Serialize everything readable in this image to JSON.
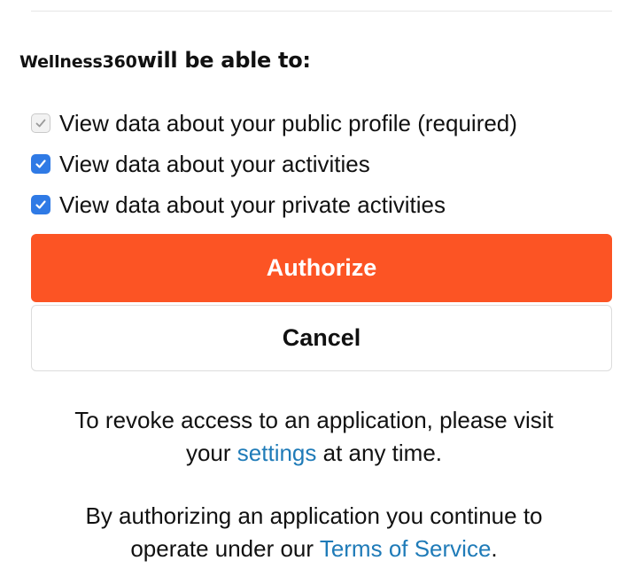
{
  "header": {
    "app_name": "Wellness360",
    "heading_suffix": "will be able to:"
  },
  "permissions": [
    {
      "label": "View data about your public profile (required)",
      "checked": true,
      "disabled": true
    },
    {
      "label": "View data about your activities",
      "checked": true,
      "disabled": false
    },
    {
      "label": "View data about your private activities",
      "checked": true,
      "disabled": false
    }
  ],
  "buttons": {
    "authorize_label": "Authorize",
    "cancel_label": "Cancel"
  },
  "revoke_note": {
    "line1": "To revoke access to an application, please visit",
    "line2_before": "your ",
    "link": "settings",
    "line2_after": " at any time."
  },
  "terms_note": {
    "line1": "By authorizing an application you continue to",
    "line2_before": "operate under our ",
    "link": "Terms of Service",
    "line2_after": "."
  },
  "colors": {
    "accent": "#fc5424",
    "checkbox_checked": "#2f7ae5",
    "link": "#1f7bb8"
  }
}
